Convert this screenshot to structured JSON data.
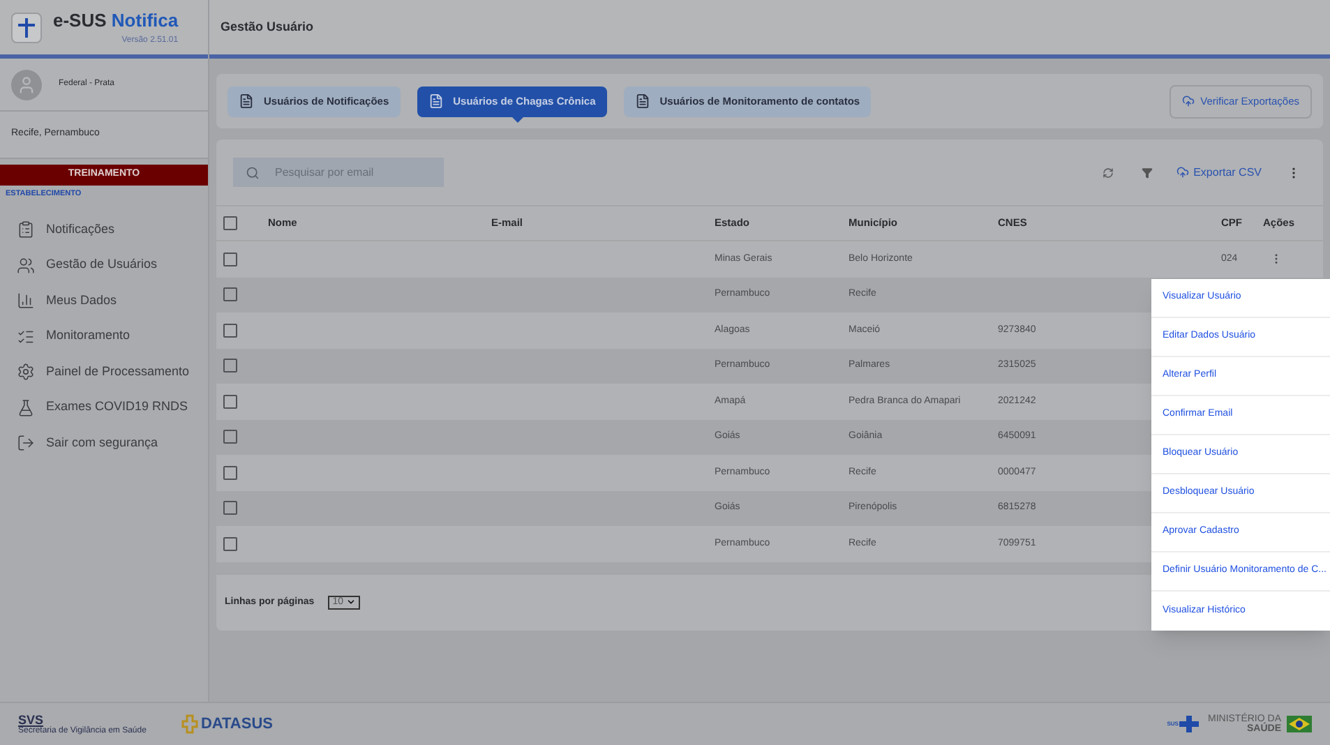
{
  "app": {
    "name_part1": "e-SUS",
    "name_part2": "Notifica",
    "version": "Versão 2.51.01"
  },
  "page_title": "Gestão Usuário",
  "user": {
    "role": "Federal - Prata",
    "location": "Recife, Pernambuco",
    "environment": "TREINAMENTO",
    "section_label": "ESTABELECIMENTO"
  },
  "sidebar": {
    "items": [
      {
        "label": "Notificações"
      },
      {
        "label": "Gestão de Usuários"
      },
      {
        "label": "Meus Dados"
      },
      {
        "label": "Monitoramento"
      },
      {
        "label": "Painel de Processamento"
      },
      {
        "label": "Exames COVID19 RNDS"
      },
      {
        "label": "Sair com segurança"
      }
    ]
  },
  "tabs": [
    {
      "label": "Usuários de Notificações",
      "selected": false
    },
    {
      "label": "Usuários de Chagas Crônica",
      "selected": true
    },
    {
      "label": "Usuários de Monitoramento de contatos",
      "selected": false
    }
  ],
  "verify_button": "Verificar Exportações",
  "search": {
    "placeholder": "Pesquisar por email"
  },
  "export_button": "Exportar CSV",
  "table": {
    "select_all_checked": false,
    "columns": [
      "Nome",
      "E-mail",
      "Estado",
      "Município",
      "CNES",
      "CPF",
      "Ações"
    ],
    "rows": [
      {
        "checked": false,
        "estado": "Minas Gerais",
        "municipio": "Belo Horizonte",
        "cnes": "",
        "cpf": "024"
      },
      {
        "checked": false,
        "estado": "Pernambuco",
        "municipio": "Recife",
        "cnes": "",
        "cpf": ""
      },
      {
        "checked": false,
        "estado": "Alagoas",
        "municipio": "Maceió",
        "cnes": "9273840",
        "cpf": ""
      },
      {
        "checked": false,
        "estado": "Pernambuco",
        "municipio": "Palmares",
        "cnes": "2315025",
        "cpf": ""
      },
      {
        "checked": false,
        "estado": "Amapá",
        "municipio": "Pedra Branca do Amapari",
        "cnes": "2021242",
        "cpf": ""
      },
      {
        "checked": false,
        "estado": "Goiás",
        "municipio": "Goiânia",
        "cnes": "6450091",
        "cpf": ""
      },
      {
        "checked": false,
        "estado": "Pernambuco",
        "municipio": "Recife",
        "cnes": "0000477",
        "cpf": ""
      },
      {
        "checked": false,
        "estado": "Goiás",
        "municipio": "Pirenópolis",
        "cnes": "6815278",
        "cpf": ""
      },
      {
        "checked": false,
        "estado": "Pernambuco",
        "municipio": "Recife",
        "cnes": "7099751",
        "cpf": ""
      }
    ]
  },
  "pagination": {
    "label": "Linhas por páginas",
    "value": "10"
  },
  "action_menu": [
    "Visualizar Usuário",
    "Editar Dados Usuário",
    "Alterar Perfil",
    "Confirmar Email",
    "Bloquear Usuário",
    "Desbloquear Usuário",
    "Aprovar Cadastro",
    "Definir Usuário Monitoramento de C...",
    "Visualizar Histórico"
  ],
  "footer": {
    "svs": "SVS",
    "svs_sub": "Secretaria de Vigilância em Saúde",
    "datasus": "DATASUS",
    "sus": "SUS",
    "ministry_line1": "MINISTÉRIO DA",
    "ministry_line2": "SAÚDE"
  }
}
